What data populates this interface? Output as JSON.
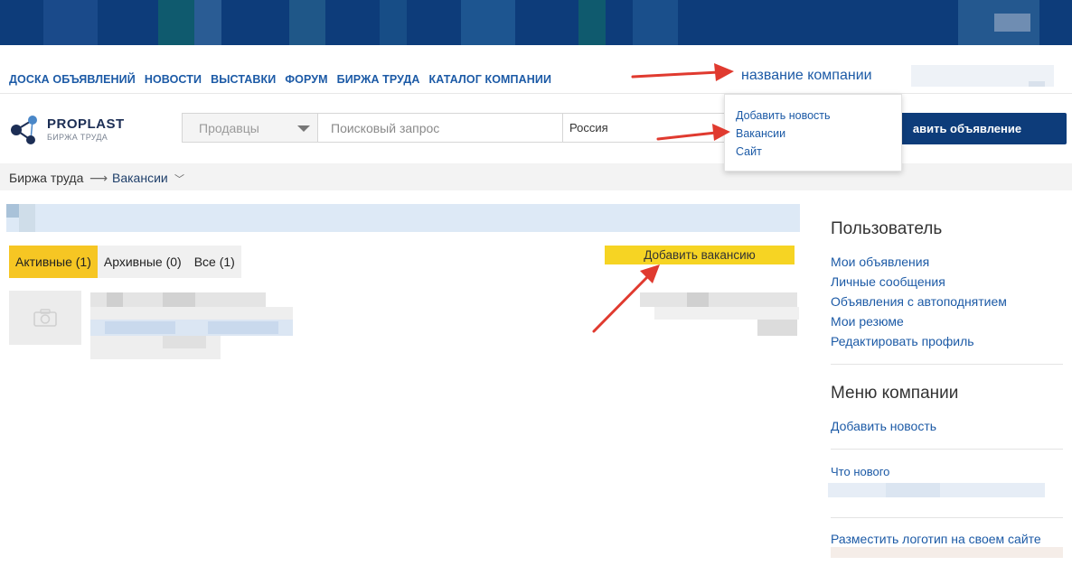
{
  "colors": {
    "brand_dark": "#0d3c7a",
    "link": "#1c5aa6",
    "accent_yellow": "#f6c623",
    "annotation_red": "#e03a2f"
  },
  "topnav": {
    "items": [
      "ДОСКА ОБЪЯВЛЕНИЙ",
      "НОВОСТИ",
      "ВЫСТАВКИ",
      "ФОРУМ",
      "БИРЖА ТРУДА",
      "КАТАЛОГ КОМПАНИИ"
    ],
    "company_name": "название компании"
  },
  "logo": {
    "title": "PROPLAST",
    "subtitle": "БИРЖА ТРУДА"
  },
  "search": {
    "category": "Продавцы",
    "placeholder": "Поисковый запрос",
    "region": "Россия"
  },
  "add_ad_button": "авить объявление",
  "company_dropdown": {
    "items": [
      "Добавить новость",
      "Вакансии",
      "Сайт"
    ]
  },
  "breadcrumb": {
    "root": "Биржа труда",
    "separator": "⟶",
    "current": "Вакансии"
  },
  "tabs": [
    "Активные (1)",
    "Архивные (0)",
    "Все (1)"
  ],
  "add_vacancy_button": "Добавить вакансию",
  "sidebar": {
    "user_title": "Пользователь",
    "user_links": [
      "Мои объявления",
      "Личные сообщения",
      "Объявления с автоподнятием",
      "Мои резюме",
      "Редактировать профиль"
    ],
    "company_title": "Меню компании",
    "company_links": [
      "Добавить новость"
    ],
    "whats_new": "Что нового",
    "logo_link": "Разместить логотип на своем сайте"
  }
}
